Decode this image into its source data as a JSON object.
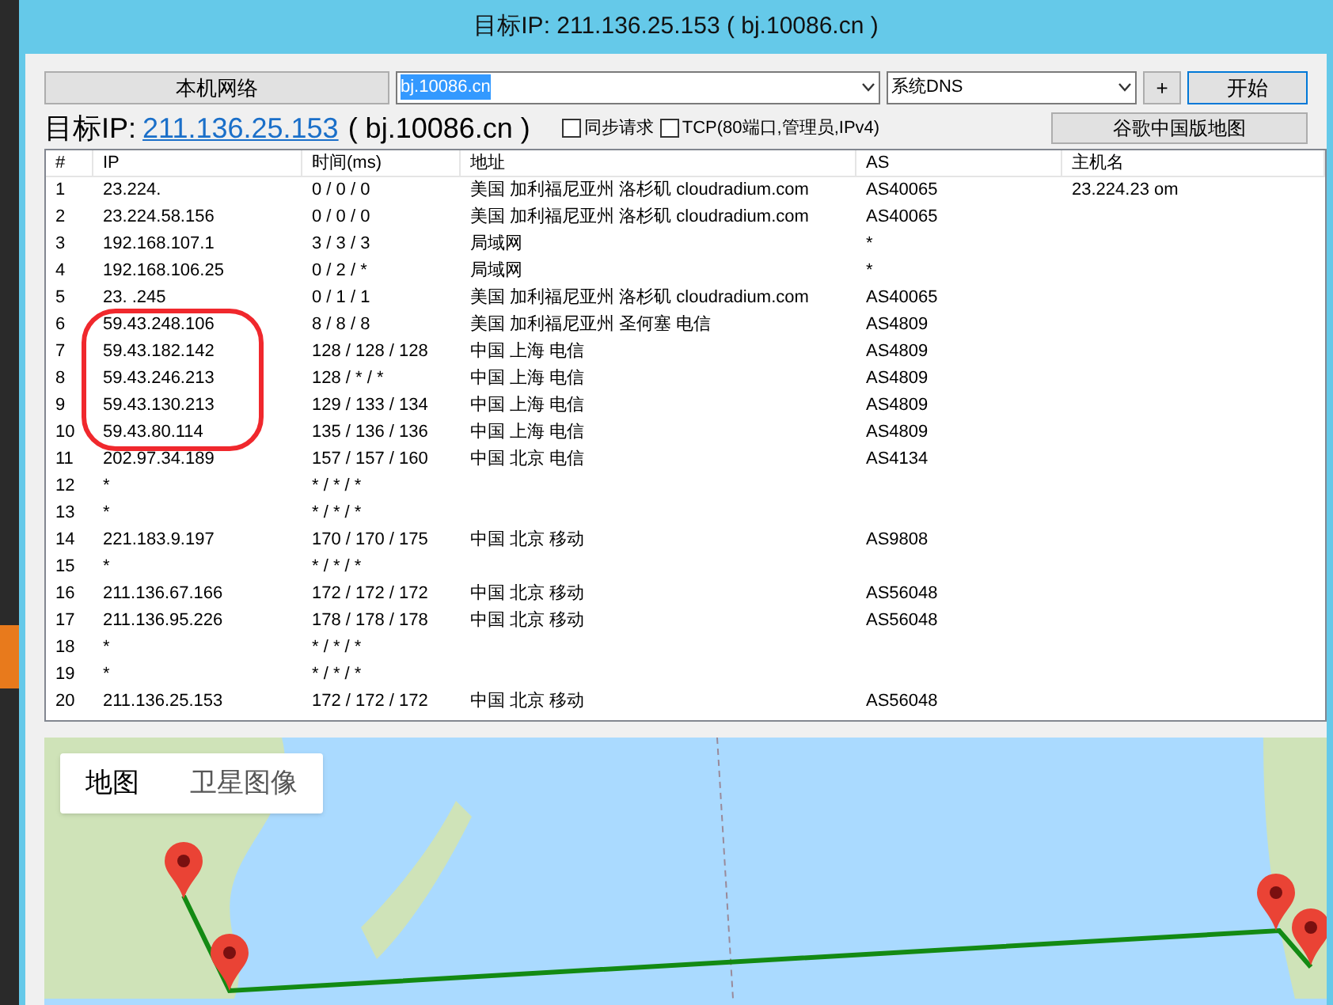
{
  "window": {
    "title": "目标IP: 211.136.25.153 ( bj.10086.cn )"
  },
  "toolbar": {
    "local_button": "本机网络",
    "host_field": {
      "value": "bj.10086.cn",
      "selected": true
    },
    "dns_select": "系统DNS",
    "add_button": "+",
    "start_button": "开始"
  },
  "target": {
    "label": "目标IP:",
    "ip": "211.136.25.153",
    "host": "( bj.10086.cn )"
  },
  "options": [
    {
      "label": "同步请求",
      "checked": false
    },
    {
      "label": "TCP(80端口,管理员,IPv4)",
      "checked": false
    }
  ],
  "map_button": "谷歌中国版地图",
  "table": {
    "columns": [
      "#",
      "IP",
      "时间(ms)",
      "地址",
      "AS",
      "主机名"
    ],
    "rows": [
      [
        "1",
        "23.224.",
        "0 / 0 / 0",
        "美国 加利福尼亚州 洛杉矶 cloudradium.com",
        "AS40065",
        "23.224.23 om"
      ],
      [
        "2",
        "23.224.58.156",
        "0 / 0 / 0",
        "美国 加利福尼亚州 洛杉矶 cloudradium.com",
        "AS40065",
        ""
      ],
      [
        "3",
        "192.168.107.1",
        "3 / 3 / 3",
        "局域网",
        "*",
        ""
      ],
      [
        "4",
        "192.168.106.25",
        "0 / 2 / *",
        "局域网",
        "*",
        ""
      ],
      [
        "5",
        "23.  .245",
        "0 / 1 / 1",
        "美国 加利福尼亚州 洛杉矶 cloudradium.com",
        "AS40065",
        ""
      ],
      [
        "6",
        "59.43.248.106",
        "8 / 8 / 8",
        "美国 加利福尼亚州 圣何塞 电信",
        "AS4809",
        ""
      ],
      [
        "7",
        "59.43.182.142",
        "128 / 128 / 128",
        "中国 上海 电信",
        "AS4809",
        ""
      ],
      [
        "8",
        "59.43.246.213",
        "128 / * / *",
        "中国 上海 电信",
        "AS4809",
        ""
      ],
      [
        "9",
        "59.43.130.213",
        "129 / 133 / 134",
        "中国 上海 电信",
        "AS4809",
        ""
      ],
      [
        "10",
        "59.43.80.114",
        "135 / 136 / 136",
        "中国 上海 电信",
        "AS4809",
        ""
      ],
      [
        "11",
        "202.97.34.189",
        "157 / 157 / 160",
        "中国 北京 电信",
        "AS4134",
        ""
      ],
      [
        "12",
        "*",
        "* / * / *",
        "",
        "",
        ""
      ],
      [
        "13",
        "*",
        "* / * / *",
        "",
        "",
        ""
      ],
      [
        "14",
        "221.183.9.197",
        "170 / 170 / 175",
        "中国 北京 移动",
        "AS9808",
        ""
      ],
      [
        "15",
        "*",
        "* / * / *",
        "",
        "",
        ""
      ],
      [
        "16",
        "211.136.67.166",
        "172 / 172 / 172",
        "中国 北京 移动",
        "AS56048",
        ""
      ],
      [
        "17",
        "211.136.95.226",
        "178 / 178 / 178",
        "中国 北京 移动",
        "AS56048",
        ""
      ],
      [
        "18",
        "*",
        "* / * / *",
        "",
        "",
        ""
      ],
      [
        "19",
        "*",
        "* / * / *",
        "",
        "",
        ""
      ],
      [
        "20",
        "211.136.25.153",
        "172 / 172 / 172",
        "中国 北京 移动",
        "AS56048",
        ""
      ]
    ]
  },
  "map": {
    "tabs": [
      {
        "label": "地图",
        "selected": true
      },
      {
        "label": "卫星图像",
        "selected": false
      }
    ]
  }
}
